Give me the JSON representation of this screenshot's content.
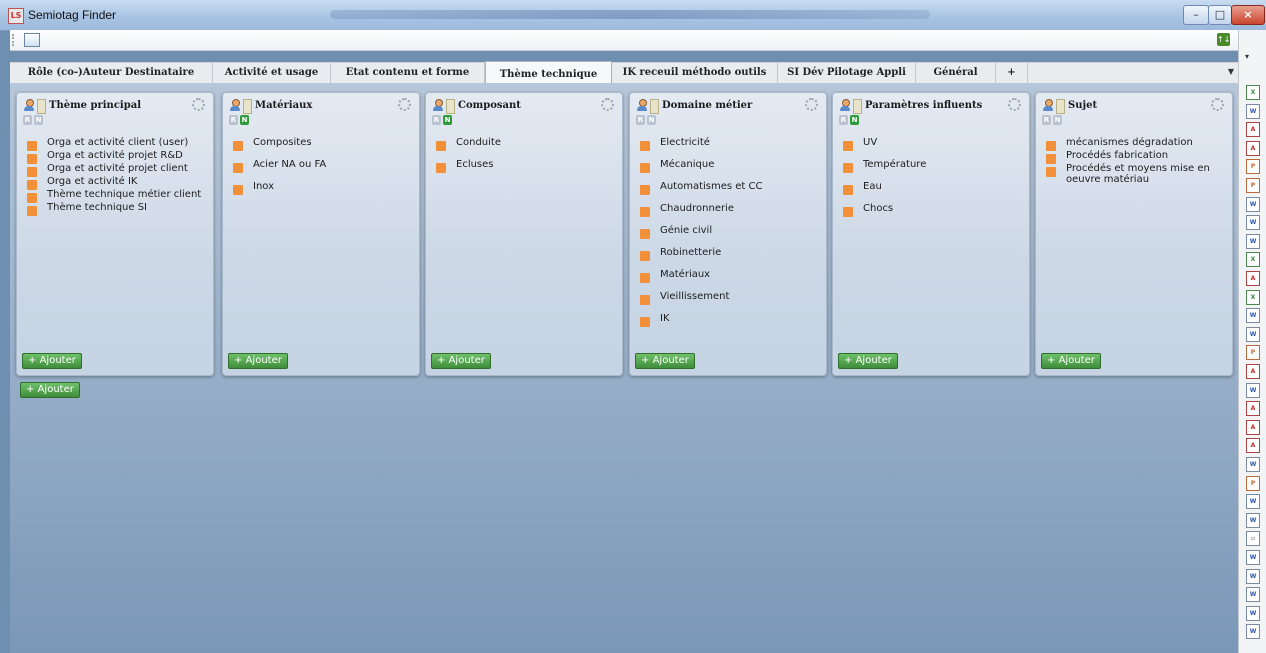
{
  "window": {
    "title": "Semiotag Finder",
    "app_icon_text": "LS"
  },
  "tabs": [
    {
      "label": "Rôle (co-)Auteur Destinataire",
      "active": false
    },
    {
      "label": "Activité et usage",
      "active": false
    },
    {
      "label": "Etat contenu et forme",
      "active": false
    },
    {
      "label": "Thème technique",
      "active": true
    },
    {
      "label": "IK receuil méthodo outils",
      "active": false
    },
    {
      "label": "SI Dév Pilotage Appli",
      "active": false
    },
    {
      "label": "Général",
      "active": false
    },
    {
      "label": "+",
      "active": false
    }
  ],
  "columns": [
    {
      "title": "Thème principal",
      "r": "R",
      "n": "N",
      "n_active": false,
      "items": [
        "Orga et activité client (user)",
        "Orga et activité projet R&D",
        "Orga et activité projet client",
        "Orga et activité IK",
        "Thème technique métier client",
        "Thème technique SI"
      ],
      "add_label": "Ajouter"
    },
    {
      "title": "Matériaux",
      "r": "R",
      "n": "N",
      "n_active": true,
      "items": [
        "Composites",
        "Acier NA ou FA",
        "Inox"
      ],
      "add_label": "Ajouter"
    },
    {
      "title": "Composant",
      "r": "R",
      "n": "N",
      "n_active": true,
      "items": [
        "Conduite",
        "Ecluses"
      ],
      "add_label": "Ajouter"
    },
    {
      "title": "Domaine métier",
      "r": "R",
      "n": "N",
      "n_active": false,
      "items": [
        "Electricité",
        "Mécanique",
        "Automatismes et CC",
        "Chaudronnerie",
        "Génie civil",
        "Robinetterie",
        "Matériaux",
        "Vieillissement",
        "IK"
      ],
      "add_label": "Ajouter"
    },
    {
      "title": "Paramètres influents",
      "r": "R",
      "n": "N",
      "n_active": true,
      "items": [
        "UV",
        "Température",
        "Eau",
        "Chocs"
      ],
      "add_label": "Ajouter"
    },
    {
      "title": "Sujet",
      "r": "R",
      "n": "N",
      "n_active": false,
      "items": [
        "mécanismes dégradation",
        "Procédés fabrication",
        "Procédés et moyens mise en oeuvre matériau"
      ],
      "add_label": "Ajouter"
    }
  ],
  "global_add_label": "Ajouter",
  "add_prefix": "+",
  "right_panel_files": [
    "xls",
    "word",
    "pdf",
    "pdf",
    "ppt",
    "ppt",
    "word",
    "word",
    "word",
    "xls",
    "pdf",
    "xls",
    "word",
    "word",
    "ppt",
    "pdf",
    "word",
    "pdf",
    "pdf",
    "pdf",
    "word",
    "ppt",
    "word",
    "word",
    "other",
    "word",
    "word",
    "word",
    "word",
    "word"
  ],
  "colors": {
    "accent_orange": "#f2903a",
    "add_green": "#3f8d3b",
    "n_green": "#2f9a3a"
  }
}
